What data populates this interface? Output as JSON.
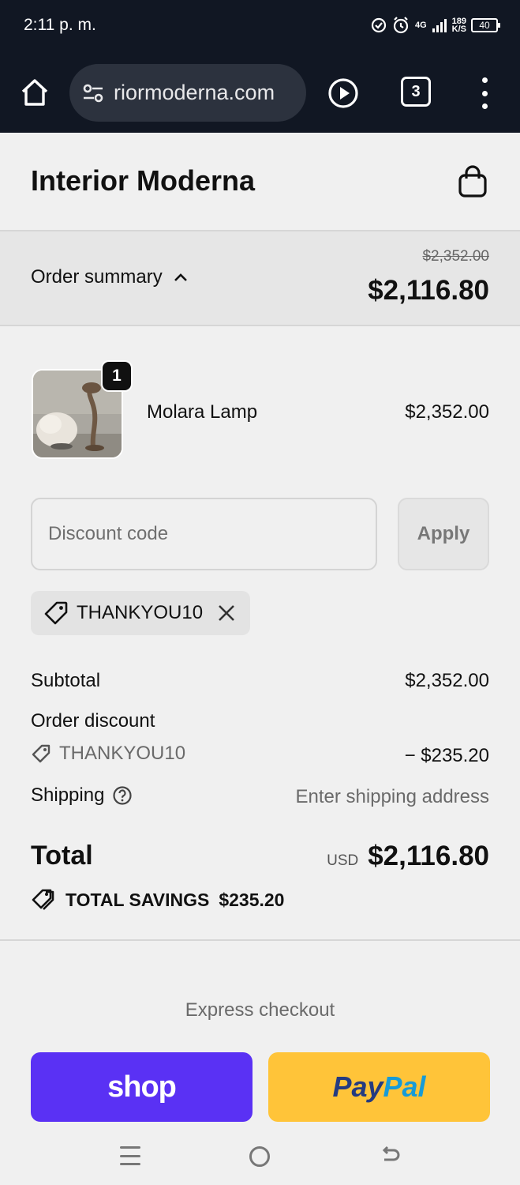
{
  "status_bar": {
    "time": "2:11 p. m.",
    "network": "4G",
    "speed_value": "189",
    "speed_unit": "K/S",
    "battery": "40"
  },
  "browser": {
    "url": "riormoderna.com",
    "tab_count": "3",
    "icons": [
      "home-icon",
      "site-settings-icon",
      "play-icon",
      "tabs-icon",
      "more-vert-icon"
    ]
  },
  "store": {
    "name": "Interior Moderna",
    "cart_icon": "shopping-bag-icon"
  },
  "summary": {
    "toggle_label": "Order summary",
    "original_total": "$2,352.00",
    "total": "$2,116.80"
  },
  "product": {
    "name": "Molara Lamp",
    "price": "$2,352.00",
    "quantity": "1"
  },
  "discount": {
    "placeholder": "Discount code",
    "value": "",
    "apply_label": "Apply",
    "applied_code": "THANKYOU10"
  },
  "totals": {
    "subtotal_label": "Subtotal",
    "subtotal_value": "$2,352.00",
    "order_discount_label": "Order discount",
    "discount_code": "THANKYOU10",
    "discount_value": "− $235.20",
    "shipping_label": "Shipping",
    "shipping_value": "Enter shipping address",
    "total_label": "Total",
    "currency": "USD",
    "total_value": "$2,116.80",
    "savings_label": "TOTAL SAVINGS",
    "savings_value": "$235.20"
  },
  "express": {
    "label": "Express checkout",
    "shop_label": "shop",
    "paypal_part1": "Pay",
    "paypal_part2": "Pal"
  },
  "colors": {
    "shop_purple": "#5a31f4",
    "paypal_yellow": "#ffc439",
    "chrome_dark": "#111723"
  }
}
